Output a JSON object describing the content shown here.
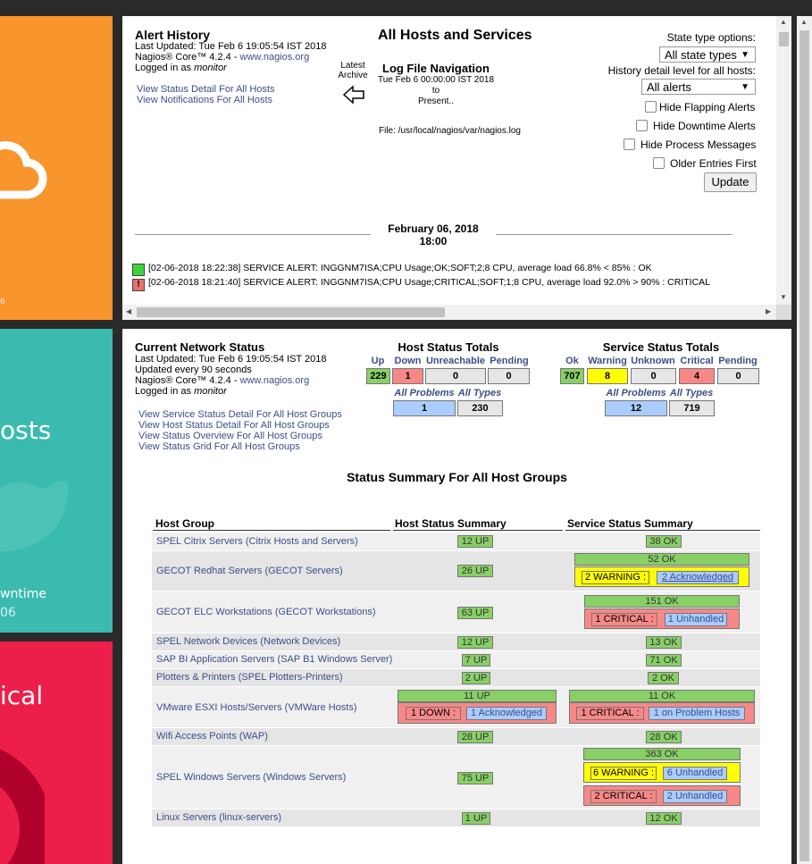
{
  "tiles": {
    "orange_footer": "6",
    "teal_label": "osts",
    "teal_sub1": "wntime",
    "teal_sub2": "06",
    "red_label": "ical"
  },
  "alert_history": {
    "title": "Alert History",
    "updated": "Last Updated: Tue Feb 6 19:05:54 IST 2018",
    "version_prefix": "Nagios® Core™ 4.2.4 - ",
    "version_link": "www.nagios.org",
    "logged_prefix": "Logged in as ",
    "user": "monitor",
    "links": [
      "View Status Detail For All Hosts",
      "View Notifications For All Hosts"
    ],
    "page_title": "All Hosts and Services",
    "latest_archive": [
      "Latest",
      "Archive"
    ],
    "nav_title": "Log File Navigation",
    "nav_from": "Tue Feb 6 00:00:00 IST 2018",
    "nav_to": "to",
    "nav_present": "Present..",
    "file": "File: /usr/local/nagios/var/nagios.log",
    "state_type_label": "State type options:",
    "state_type_value": "All state types",
    "history_label": "History detail level for all hosts:",
    "history_value": "All alerts",
    "checkboxes": [
      "Hide Flapping Alerts",
      "Hide Downtime Alerts",
      "Hide Process Messages",
      "Older Entries First"
    ],
    "update_button": "Update",
    "date_heading": "February 06, 2018",
    "time_heading": "18:00",
    "entries": [
      "[02-06-2018 18:22:38] SERVICE ALERT: INGGNM7ISA;CPU Usage;OK;SOFT;2;8 CPU, average load 66.8% < 85% : OK",
      "[02-06-2018 18:21:40] SERVICE ALERT: INGGNM7ISA;CPU Usage;CRITICAL;SOFT;1;8 CPU, average load 92.0% > 90% : CRITICAL"
    ]
  },
  "network_status": {
    "title": "Current Network Status",
    "updated": "Last Updated: Tue Feb 6 19:05:54 IST 2018",
    "interval": "Updated every 90 seconds",
    "version_prefix": "Nagios® Core™ 4.2.4 - ",
    "version_link": "www.nagios.org",
    "logged_prefix": "Logged in as ",
    "user": "monitor",
    "links": [
      "View Service Status Detail For All Host Groups",
      "View Host Status Detail For All Host Groups",
      "View Status Overview For All Host Groups",
      "View Status Grid For All Host Groups"
    ],
    "host_totals": {
      "title": "Host Status Totals",
      "labels": [
        "Up",
        "Down",
        "Unreachable",
        "Pending"
      ],
      "values": [
        "229",
        "1",
        "0",
        "0"
      ],
      "sub_labels": [
        "All Problems",
        "All Types"
      ],
      "sub_values": [
        "1",
        "230"
      ]
    },
    "service_totals": {
      "title": "Service Status Totals",
      "labels": [
        "Ok",
        "Warning",
        "Unknown",
        "Critical",
        "Pending"
      ],
      "values": [
        "707",
        "8",
        "0",
        "4",
        "0"
      ],
      "sub_labels": [
        "All Problems",
        "All Types"
      ],
      "sub_values": [
        "12",
        "719"
      ]
    },
    "summary_title": "Status Summary For All Host Groups",
    "table_headers": [
      "Host Group",
      "Host Status Summary",
      "Service Status Summary"
    ],
    "rows": [
      {
        "group": "SPEL Citrix Servers (Citrix Hosts and Servers)",
        "host": "12 UP",
        "service": "38 OK"
      },
      {
        "group": "GECOT Redhat Servers (GECOT Servers)",
        "host": "26 UP",
        "service": "52 OK",
        "svc_extra_label": "2 WARNING :",
        "svc_extra_link": "2 Acknowledged"
      },
      {
        "group": "GECOT ELC Workstations (GECOT Workstations)",
        "host": "63 UP",
        "service": "151 OK",
        "svc_extra_label": "1 CRITICAL :",
        "svc_extra_link": "1 Unhandled"
      },
      {
        "group": "SPEL Network Devices (Network Devices)",
        "host": "12 UP",
        "service": "13 OK"
      },
      {
        "group": "SAP BI Application Servers (SAP B1 Windows Server)",
        "host": "7 UP",
        "service": "71 OK"
      },
      {
        "group": "Plotters & Printers (SPEL Plotters-Printers)",
        "host": "2 UP",
        "service": "2 OK"
      },
      {
        "group": "VMware ESXI Hosts/Servers (VMWare Hosts)",
        "host": "11 UP",
        "host_extra_label": "1 DOWN :",
        "host_extra_link": "1 Acknowledged",
        "service": "11 OK",
        "svc_extra_label": "1 CRITICAL :",
        "svc_extra_link": "1 on Problem Hosts"
      },
      {
        "group": "Wifi Access Points (WAP)",
        "host": "28 UP",
        "service": "28 OK"
      },
      {
        "group": "SPEL Windows Servers (Windows Servers)",
        "host": "75 UP",
        "service": "363 OK",
        "svc_extra_label": "6 WARNING :",
        "svc_extra_link": "6 Unhandled",
        "svc_extra2_label": "2 CRITICAL :",
        "svc_extra2_link": "2 Unhandled"
      },
      {
        "group": "Linux Servers (linux-servers)",
        "host": "1 UP",
        "service": "12 OK"
      }
    ]
  },
  "colors": {
    "tile_orange": "#f8952c",
    "tile_teal": "#3bbbaf",
    "tile_red": "#ec1e4a",
    "ok_green": "#88d066",
    "critical_red": "#f88888",
    "warning_yellow": "#ffff00",
    "link_blue": "#3c4e8a"
  }
}
